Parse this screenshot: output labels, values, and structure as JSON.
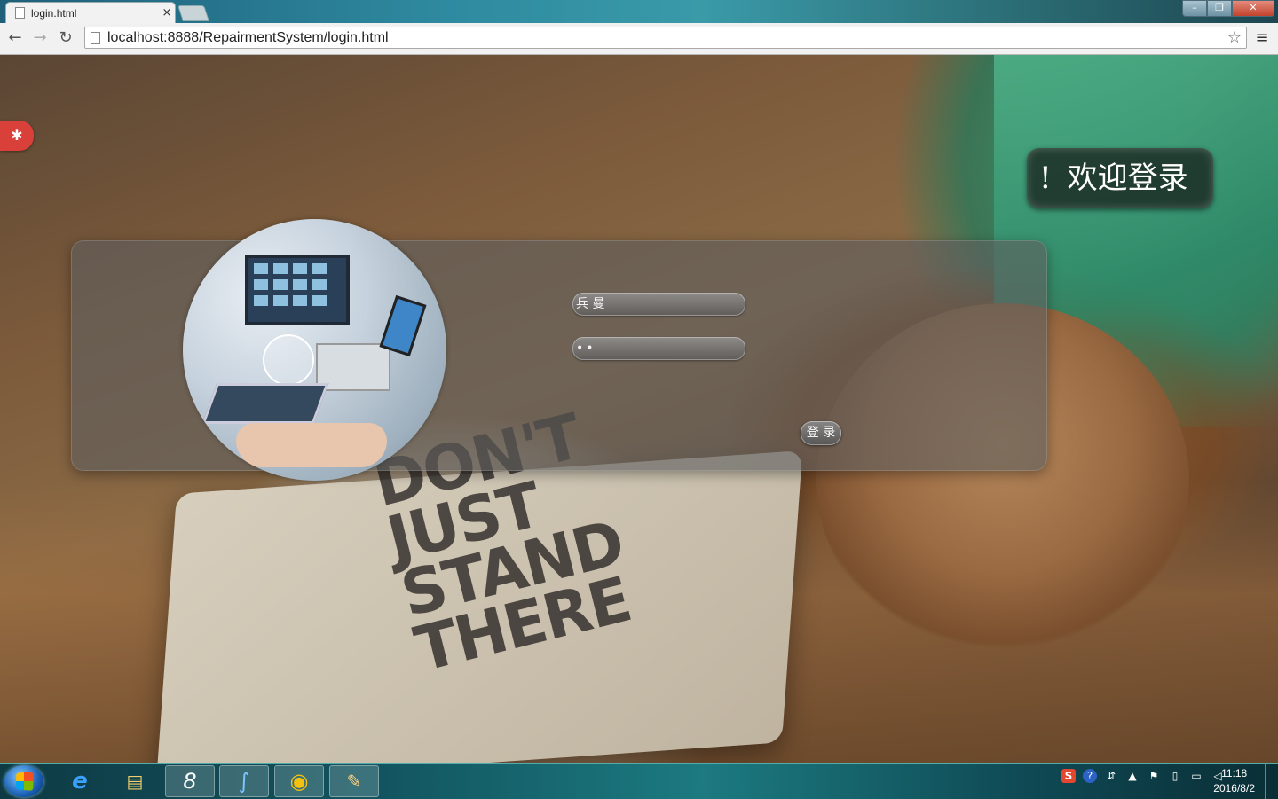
{
  "browser": {
    "tab_title": "login.html",
    "tab_close": "×",
    "url": "localhost:8888/RepairmentSystem/login.html",
    "nav_back": "←",
    "nav_forward": "→",
    "nav_reload": "↻",
    "bookmark_star": "☆",
    "menu_icon": "≡",
    "window": {
      "minimize": "–",
      "maximize": "❐",
      "close": "✕"
    }
  },
  "page": {
    "welcome_bang": "!",
    "welcome_text": "欢迎登录",
    "username_value": "兵 曼",
    "password_value": "••",
    "login_button": "登 录",
    "settings_icon": "✱",
    "poster_text": [
      "DON'T",
      "JUST",
      "STAND",
      "THERE"
    ]
  },
  "taskbar": {
    "apps": [
      {
        "name": "ie",
        "glyph": "e",
        "active": false
      },
      {
        "name": "explorer",
        "glyph": "▤",
        "active": false
      },
      {
        "name": "eclipse-8",
        "glyph": "8",
        "active": true
      },
      {
        "name": "mysql",
        "glyph": "∫",
        "active": true
      },
      {
        "name": "chrome",
        "glyph": "◉",
        "active": true
      },
      {
        "name": "paint",
        "glyph": "✎",
        "active": true
      }
    ],
    "tray_sogou": "S",
    "tray_help": "?",
    "clock_time": "11:18",
    "clock_date": "2016/8/2"
  },
  "colors": {
    "settings_tab": "#d9403a",
    "taskbar": "#125560"
  }
}
